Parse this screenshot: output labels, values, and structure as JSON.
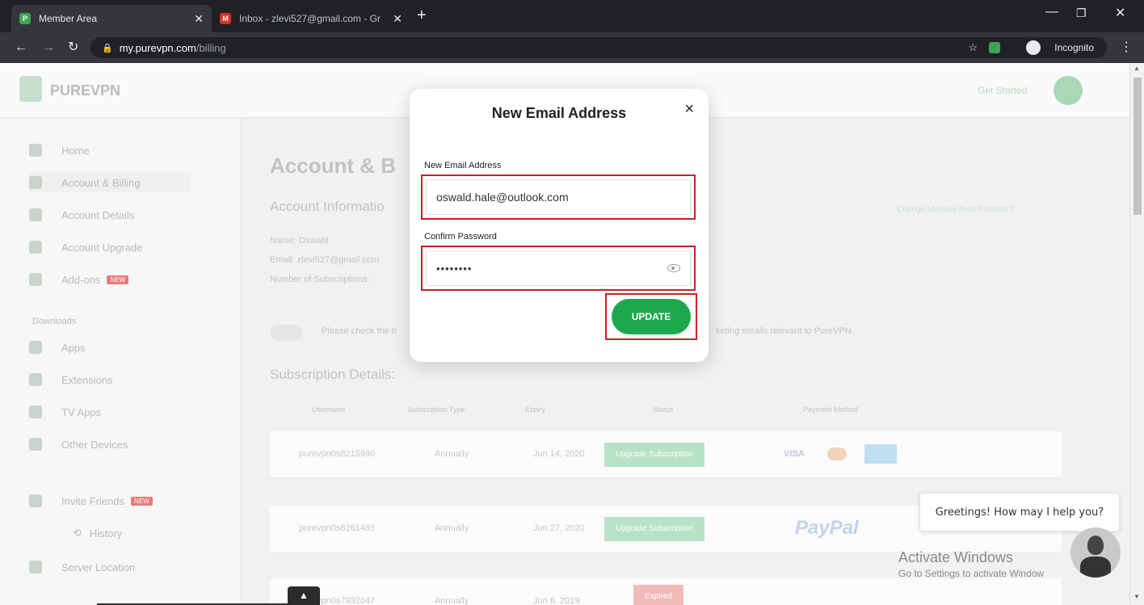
{
  "browser": {
    "tabs": [
      {
        "title": "Member Area",
        "active": true
      },
      {
        "title": "Inbox - zlevi527@gmail.com - Gr",
        "active": false
      }
    ],
    "url_host": "my.purevpn.com",
    "url_path": "/billing",
    "incognito_label": "Incognito",
    "new_tab": "+"
  },
  "site": {
    "brand": "PUREVPN",
    "get_started": "Get Started"
  },
  "sidebar": {
    "items": [
      {
        "label": "Home"
      },
      {
        "label": "Account & Billing"
      },
      {
        "label": "Account Details"
      },
      {
        "label": "Account Upgrade"
      },
      {
        "label": "Add-ons"
      },
      {
        "label": "Apps"
      },
      {
        "label": "Extensions"
      },
      {
        "label": "TV Apps"
      },
      {
        "label": "Other Devices"
      },
      {
        "label": "Invite Friends"
      },
      {
        "label": "History"
      },
      {
        "label": "Server Location"
      }
    ],
    "section_downloads": "Downloads",
    "new_badge": "NEW"
  },
  "main": {
    "heading": "Account & B",
    "account_info": "Account Informatio",
    "change_password": "Change Member Area Password",
    "name_label": "Name:",
    "name_value": "Oswald",
    "email_label": "Email:",
    "email_value": "zlevi527@gmail.com",
    "subs_label": "Number of Subscriptions:",
    "marketing_left": "Please check the b",
    "marketing_right": "keting emails relevant to PureVPN.",
    "subscription_details": "Subscription Details:",
    "columns": [
      "Username",
      "Subscription Type",
      "Expiry",
      "Status",
      "Payment Method"
    ],
    "rows": [
      {
        "username": "purevpn0s8215990",
        "type": "Annually",
        "expiry": "Jun 14, 2020",
        "status": "Upgrade Subscription"
      },
      {
        "username": "purevpn0s8261485",
        "type": "Annually",
        "expiry": "Jun 27, 2020",
        "status": "Upgrade Subscription"
      },
      {
        "username": "purevpn0s7932047",
        "type": "Annually",
        "expiry": "Jun 6, 2019",
        "status": "Expired"
      }
    ],
    "card_visa": "VISA",
    "paypal": "PayPal"
  },
  "modal": {
    "title": "New Email Address",
    "close": "×",
    "email_label": "New Email Address",
    "email_value": "oswald.hale@outlook.com",
    "password_label": "Confirm Password",
    "password_value": "••••••••",
    "update_label": "UPDATE"
  },
  "chat": {
    "greeting": "Greetings! How may I help you?"
  },
  "watermark": {
    "line1": "Activate Windows",
    "line2": "Go to Settings to activate Window"
  },
  "colors": {
    "accent_green": "#1ea84e",
    "highlight_red": "#c8202a"
  }
}
